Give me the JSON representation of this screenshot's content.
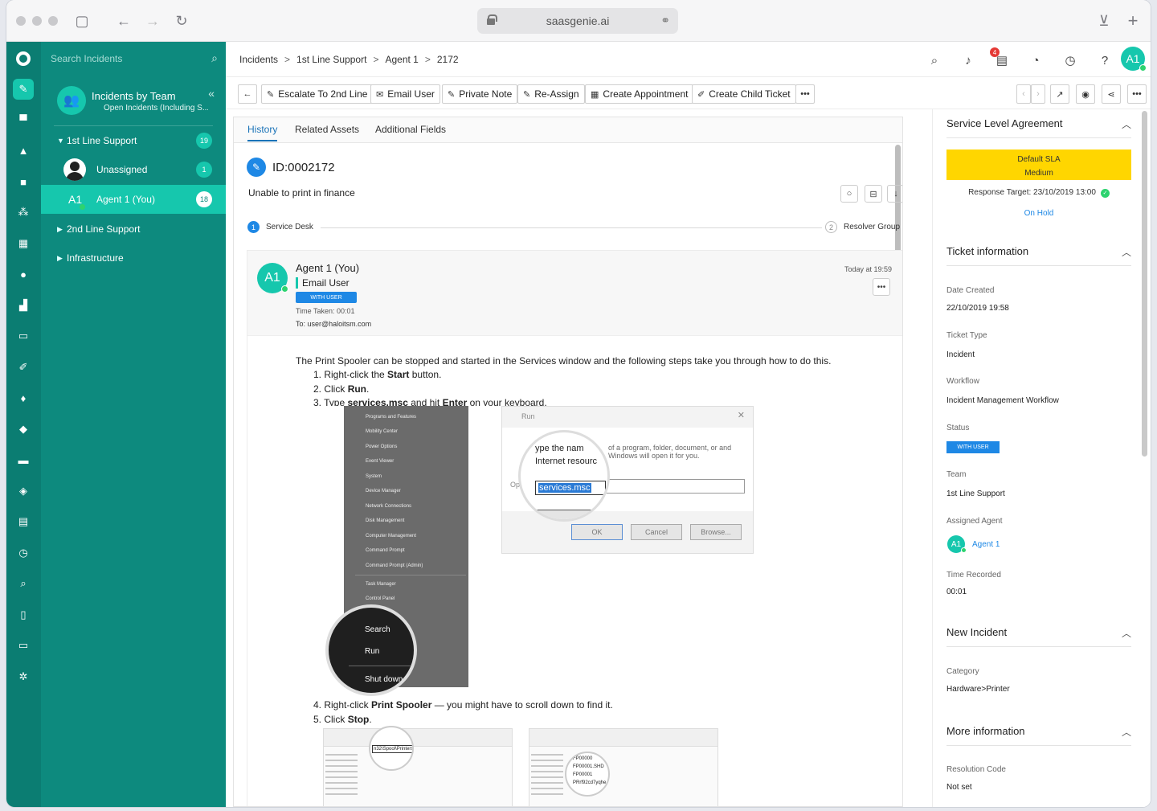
{
  "browser": {
    "url": "saasgenie.ai"
  },
  "nav": {
    "search_placeholder": "Search Incidents",
    "team_title": "Incidents by Team",
    "team_subtitle": "Open Incidents (Including S...",
    "items": [
      {
        "label": "1st Line Support",
        "count": "19"
      },
      {
        "label": "Unassigned",
        "count": "1"
      },
      {
        "label": "Agent 1 (You)",
        "initials": "A1",
        "count": "18"
      },
      {
        "label": "2nd Line Support"
      },
      {
        "label": "Infrastructure"
      }
    ]
  },
  "breadcrumb": [
    "Incidents",
    "1st Line Support",
    "Agent 1",
    "2172"
  ],
  "header": {
    "notification_count": "4",
    "avatar": "A1"
  },
  "actions": {
    "escalate": "Escalate To 2nd Line",
    "email": "Email User",
    "note": "Private Note",
    "reassign": "Re-Assign",
    "appointment": "Create Appointment",
    "child": "Create Child Ticket"
  },
  "tabs": [
    "History",
    "Related Assets",
    "Additional Fields"
  ],
  "ticket": {
    "id": "ID:0002172",
    "summary": "Unable to print in finance",
    "step1_num": "1",
    "step1": "Service Desk",
    "step2_num": "2",
    "step2": "Resolver Group"
  },
  "note": {
    "initials": "A1",
    "author": "Agent 1 (You)",
    "type": "Email User",
    "status": "WITH USER",
    "time_taken": "Time Taken: 00:01",
    "to": "To: user@haloitsm.com",
    "date": "Today at 19:59",
    "intro": "The Print Spooler can be stopped and started in the Services window and the following steps take you through how to do this.",
    "steps": [
      {
        "pre": "1. Right-click the ",
        "b": "Start",
        "post": " button."
      },
      {
        "pre": "2. Click ",
        "b": "Run",
        "post": "."
      },
      {
        "pre": "3. Type ",
        "b": "services.msc",
        "mid": " and hit ",
        "b2": "Enter",
        "post": " on your keyboard."
      },
      {
        "pre": "4. Right-click ",
        "b": "Print Spooler",
        "post": " — you might have to scroll down to find it."
      },
      {
        "pre": "5. Click ",
        "b": "Stop",
        "post": "."
      }
    ],
    "winmenu": [
      "Programs and Features",
      "Mobility Center",
      "Power Options",
      "Event Viewer",
      "System",
      "Device Manager",
      "Network Connections",
      "Disk Management",
      "Computer Management",
      "Command Prompt",
      "Command Prompt (Admin)",
      "Task Manager",
      "Control Panel"
    ],
    "winmenu_mag": [
      "Search",
      "Run",
      "Shut down"
    ],
    "run": {
      "title": "Run",
      "desc": "of a program, folder, document, or and Windows will open it for you.",
      "mag1": "ype the nam",
      "mag2": "Internet resourc",
      "label": "Op",
      "value": "services.msc",
      "ok": "OK",
      "cancel": "Cancel",
      "browse": "Browse..."
    },
    "explorer": {
      "path": "n32\\Spool\\Printers",
      "files": [
        "FP00000",
        "FP00001.SHD",
        "FP00001",
        "PRrf92cd7yqhe"
      ]
    }
  },
  "right": {
    "sla_title": "Service Level Agreement",
    "sla_name": "Default SLA",
    "sla_priority": "Medium",
    "response_target": "Response Target: 23/10/2019 13:00",
    "on_hold": "On Hold",
    "ticket_info_title": "Ticket information",
    "date_created_label": "Date Created",
    "date_created": "22/10/2019 19:58",
    "ticket_type_label": "Ticket Type",
    "ticket_type": "Incident",
    "workflow_label": "Workflow",
    "workflow": "Incident Management Workflow",
    "status_label": "Status",
    "status": "WITH USER",
    "team_label": "Team",
    "team": "1st Line Support",
    "agent_label": "Assigned Agent",
    "agent_initials": "A1",
    "agent": "Agent 1",
    "time_label": "Time Recorded",
    "time": "00:01",
    "new_incident_title": "New Incident",
    "category_label": "Category",
    "category": "Hardware>Printer",
    "more_info_title": "More information",
    "resolution_label": "Resolution Code",
    "resolution": "Not set"
  },
  "colors": {
    "rail": "#0b7d72",
    "nav": "#0d8a7e",
    "accent": "#16c7ad",
    "link": "#1e88e5",
    "sla": "#ffd600"
  }
}
